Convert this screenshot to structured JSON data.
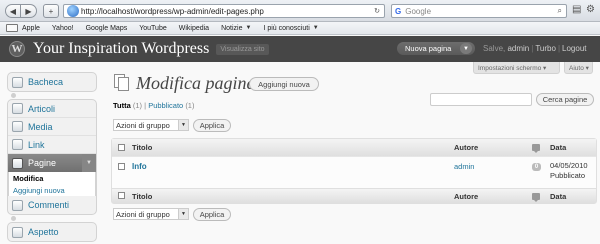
{
  "browser": {
    "url": "http://localhost/wordpress/wp-admin/edit-pages.php",
    "search_placeholder": "Google",
    "search_engine_glyph": "G",
    "bookmarks": [
      {
        "label": "Apple"
      },
      {
        "label": "Yahoo!"
      },
      {
        "label": "Google Maps"
      },
      {
        "label": "YouTube"
      },
      {
        "label": "Wikipedia"
      },
      {
        "label": "Notizie",
        "has_menu": true
      },
      {
        "label": "I più conosciuti",
        "has_menu": true
      }
    ]
  },
  "header": {
    "logo_glyph": "W",
    "site_title": "Your Inspiration Wordpress",
    "visit_site": "Visualizza sito",
    "new_page_button": "Nuova pagina",
    "greeting": "Salve, ",
    "username": "admin",
    "link_turbo": "Turbo",
    "link_logout": "Logout",
    "separator": "|"
  },
  "screen_meta": {
    "screen_options": "Impostazioni schermo ▾",
    "help": "Aiuto ▾"
  },
  "menu": {
    "dashboard": "Bacheca",
    "posts": "Articoli",
    "media": "Media",
    "links": "Link",
    "pages": "Pagine",
    "pages_sub_edit": "Modifica",
    "pages_sub_add": "Aggiungi nuova",
    "comments": "Commenti",
    "appearance": "Aspetto"
  },
  "main": {
    "heading": "Modifica pagine",
    "add_new": "Aggiungi nuova",
    "filter_all": "Tutta",
    "filter_all_count": "(1)",
    "filter_published": "Pubblicato",
    "filter_published_count": "(1)",
    "filter_separator": "|",
    "search_value": "",
    "search_button": "Cerca pagine",
    "bulk_actions": "Azioni di gruppo",
    "apply": "Applica"
  },
  "table": {
    "col_title": "Titolo",
    "col_author": "Autore",
    "col_date": "Data",
    "rows": [
      {
        "title": "Info",
        "author": "admin",
        "comments": "0",
        "date": "04/05/2010",
        "status": "Pubblicato"
      }
    ]
  },
  "colors": {
    "link": "#21759b",
    "header_bg": "#464646",
    "active_menu": "#7a7a7a"
  }
}
